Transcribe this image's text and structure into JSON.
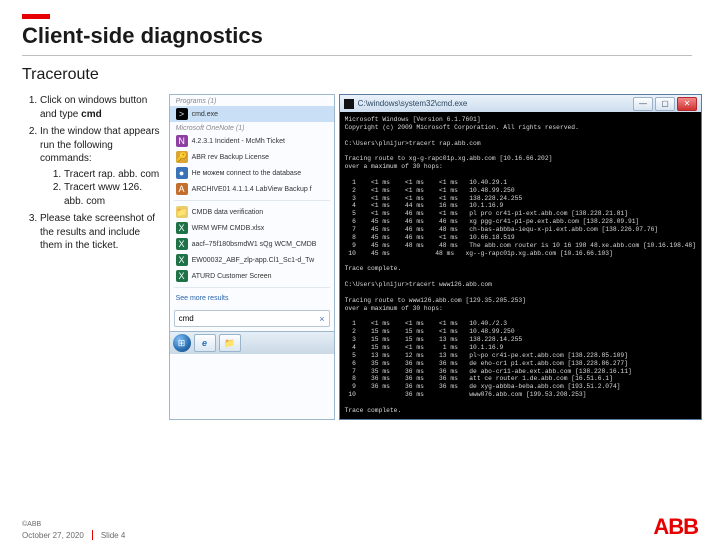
{
  "header": {
    "title": "Client-side diagnostics",
    "subtitle": "Traceroute"
  },
  "steps": {
    "s1_pre": "Click on windows button and type ",
    "s1_cmd": "cmd",
    "s2_intro": "In the window that appears run the following commands:",
    "s2a": "Tracert rap. abb. com",
    "s2b": "Tracert www 126. abb. com",
    "s3": "Please take screenshot of the results and include them in the ticket."
  },
  "startmenu": {
    "programs_label": "Programs (1)",
    "top_item": "cmd.exe",
    "onenote_label": "Microsoft OneNote (1)",
    "items": [
      "4.2.3.1 Incident - McMh Ticket",
      "ABR rev Backup License",
      "Не можем connect to the database",
      "ARCHIVE01 4.1.1.4 LabView Backup f",
      "WRM WFM CMDB.xlsx",
      "aacf–75f180bsmdW1 sQg WCM_CMDB",
      "EW00032_ABF_zlp-app.Cl1_Sc1-d_Tw",
      "ATURD Customer Screen"
    ],
    "see_more": "See more results",
    "search_value": "cmd",
    "cmdb_label": "CMDB data verification"
  },
  "taskbar": {
    "ie_icon": "e",
    "folder_icon": "📁"
  },
  "terminal": {
    "title": "C:\\windows\\system32\\cmd.exe",
    "banner1": "Microsoft Windows [Version 6.1.7601]",
    "banner2": "Copyright (c) 2009 Microsoft Corporation. All rights reserved.",
    "prompt1": "C:\\Users\\plnijur>tracert rap.abb.com",
    "trace1_hdr1": "Tracing route to xg-g-rapc01p.xg.abb.com [10.16.66.202]",
    "trace1_hdr2": "over a maximum of 30 hops:",
    "hops1": [
      "  1    <1 ms    <1 ms    <1 ms   10.40.29.1",
      "  2    <1 ms    <1 ms    <1 ms   10.48.99.250",
      "  3    <1 ms    <1 ms    <1 ms   138.228.24.255",
      "  4    <1 ms    44 ms    16 ms   10.1.16.9",
      "  5    <1 ms    46 ms    <1 ms   pl pro cr41-p1-ext.abb.com [138.228.21.81]",
      "  6    45 ms    46 ms    46 ms   xg pgg-cr41-p1-pe.ext.abb.com [138.228.09.91]",
      "  7    45 ms    46 ms    48 ms   ch-bas-abbba-iequ-x-pi.ext.abb.com [138.226.07.76]",
      "  8    45 ms    46 ms    <1 ms   10.66.18.519",
      "  9    45 ms    48 ms    48 ms   The abb.com router is 10 16 198 48.xe.abb.com [10.16.198.48]",
      " 10    45 ms            48 ms   xg--g-rapc01p.xg.abb.com [10.16.66.103]"
    ],
    "trace1_done": "Trace complete.",
    "prompt2": "C:\\Users\\plnijur>tracert www126.abb.com",
    "trace2_hdr1": "Tracing route to www126.abb.com [129.35.205.253]",
    "trace2_hdr2": "over a maximum of 30 hops:",
    "hops2": [
      "  1    <1 ms    <1 ms    <1 ms   10.40./2.3",
      "  2    15 ms    15 ms    <1 ms   10.48.99.250",
      "  3    15 ms    15 ms    13 ms   138.228.14.255",
      "  4    15 ms    <1 ms     1 ms   10.1.16.9",
      "  5    13 ms    12 ms    13 ms   pl~po cr41-pe.ext.abb.com [138.228.85.109]",
      "  6    35 ms    36 ms    36 ms   de eho-cr1 p1.ext.abb.com [138.228.86.277]",
      "  7    35 ms    36 ms    36 ms   de abo-cr11-abe.ext.abb.com [138.228.16.11]",
      "  8    36 ms    36 ms    36 ms   att ce router 1.de.abb.com [16.51.6.1]",
      "  9    36 ms    36 ms    36 ms   de xyg-abbba-beba.abb.com [193.51.2.074]",
      " 10             36 ms            www076.abb.com [199.53.208.253]"
    ],
    "trace2_done": "Trace complete."
  },
  "footer": {
    "copy": "©ABB",
    "date": "October 27, 2020",
    "slide": "Slide 4"
  }
}
